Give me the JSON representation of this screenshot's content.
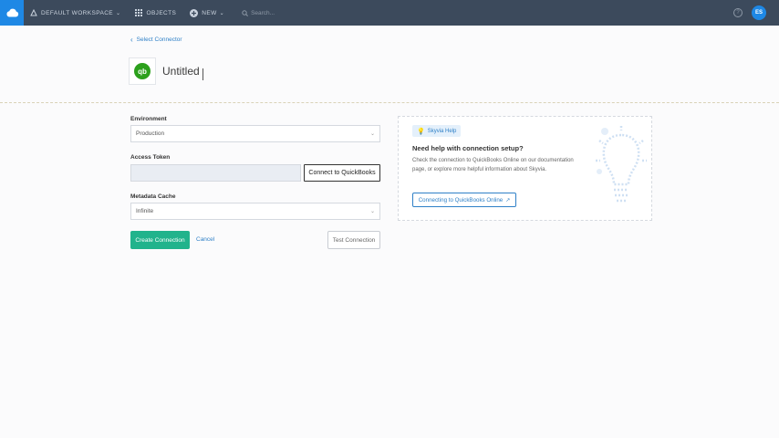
{
  "topbar": {
    "workspace": "DEFAULT WORKSPACE",
    "objects": "OBJECTS",
    "new": "NEW",
    "search_placeholder": "Search...",
    "help": "?",
    "avatar": "ES"
  },
  "header": {
    "back": "Select Connector",
    "logo_text": "qb",
    "title": "Untitled"
  },
  "form": {
    "environment_label": "Environment",
    "environment_value": "Production",
    "token_label": "Access Token",
    "connect_button": "Connect to QuickBooks",
    "cache_label": "Metadata Cache",
    "cache_value": "Infinite",
    "create_button": "Create Connection",
    "cancel_button": "Cancel",
    "test_button": "Test Connection"
  },
  "help": {
    "badge": "Skyvia Help",
    "title": "Need help with connection setup?",
    "text": "Check the connection to QuickBooks Online on our documentation page, or explore more helpful information about Skyvia.",
    "link": "Connecting to QuickBooks Online"
  },
  "colors": {
    "topbar": "#3c4a5c",
    "brand": "#1e88e5",
    "accent": "#21b38c",
    "link": "#2f80c7",
    "quickbooks": "#2ca01c"
  }
}
